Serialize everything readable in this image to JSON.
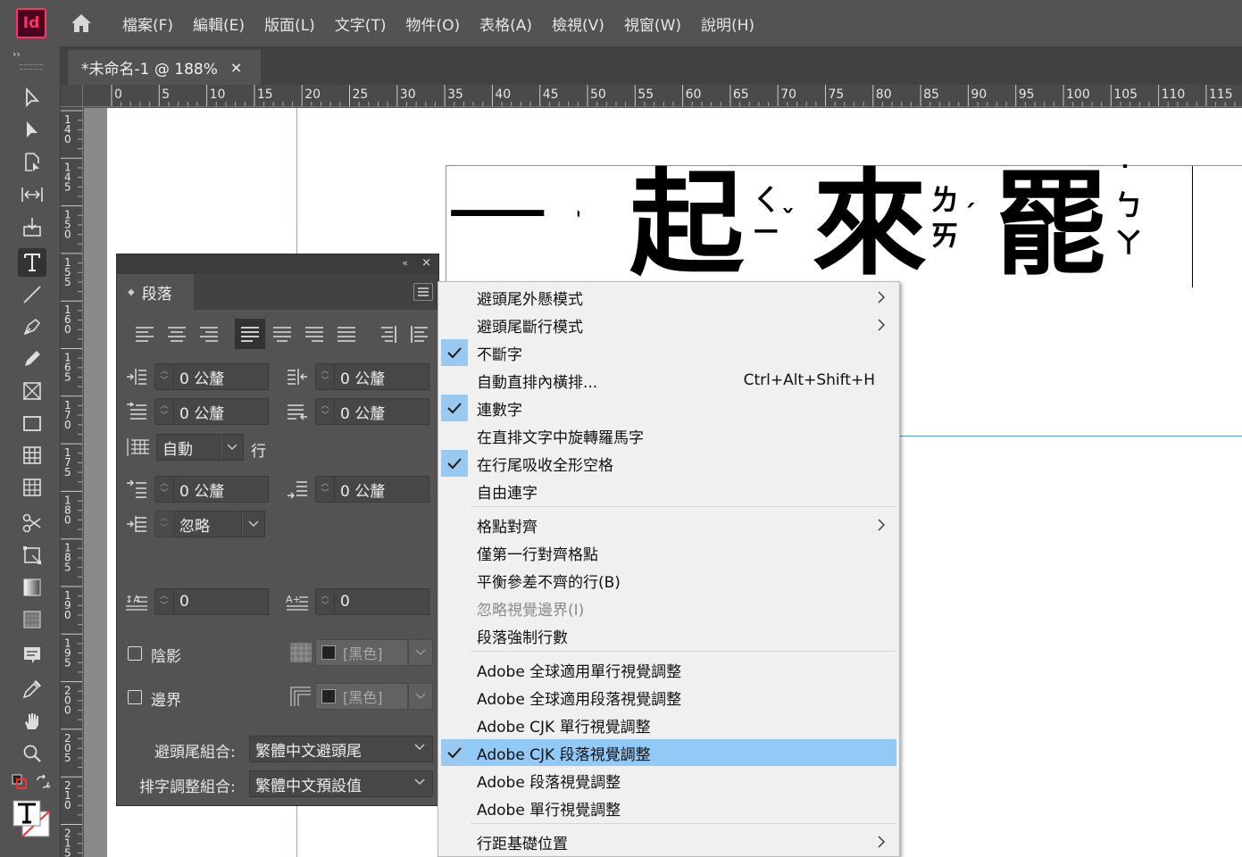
{
  "app": {
    "logo": "Id"
  },
  "menu": [
    "檔案(F)",
    "編輯(E)",
    "版面(L)",
    "文字(T)",
    "物件(O)",
    "表格(A)",
    "檢視(V)",
    "視窗(W)",
    "說明(H)"
  ],
  "tab": {
    "title": "*未命名-1 @ 188%",
    "close": "×"
  },
  "ruler": {
    "h_labels": [
      "0",
      "5",
      "10",
      "15",
      "20",
      "25",
      "30",
      "35",
      "40",
      "45",
      "50",
      "55",
      "60",
      "65",
      "70",
      "75",
      "80",
      "85",
      "90",
      "95",
      "100",
      "105",
      "110",
      "115"
    ],
    "v_labels": [
      "140",
      "145",
      "150",
      "155",
      "160",
      "165",
      "170",
      "175",
      "180",
      "185",
      "190",
      "195",
      "200",
      "205",
      "210",
      "215"
    ]
  },
  "canvas_text": {
    "chars": [
      "一",
      "起",
      "來",
      "罷"
    ],
    "zhuyin": [
      "ˋ",
      "ㄑ",
      "ㄧ",
      "ˇ",
      "ㄌ",
      "ㄞ",
      "ˊ",
      "˙",
      "ㄅ",
      "ㄚ"
    ]
  },
  "panel": {
    "title": "段落",
    "collapse": "«",
    "close": "×",
    "left_indent": "0 公釐",
    "right_indent": "0 公釐",
    "first_line_indent": "0 公釐",
    "last_line_indent": "0 公釐",
    "auto_leading": "自動",
    "leading_unit": "行",
    "space_before": "0 公釐",
    "space_after": "0 公釐",
    "align_to_grid": "忽略",
    "drop_cap_lines": "0",
    "drop_cap_chars": "0",
    "shading_label": "陰影",
    "border_label": "邊界",
    "shading_color": "[黑色]",
    "border_color": "[黑色]",
    "kinsoku_label": "避頭尾組合:",
    "kinsoku_value": "繁體中文避頭尾",
    "mojikumi_label": "排字調整組合:",
    "mojikumi_value": "繁體中文預設值"
  },
  "context_menu": {
    "items": [
      {
        "label": "避頭尾外懸模式",
        "submenu": true
      },
      {
        "label": "避頭尾斷行模式",
        "submenu": true
      },
      {
        "label": "不斷字",
        "checked": true
      },
      {
        "label": "自動直排內橫排...",
        "shortcut": "Ctrl+Alt+Shift+H"
      },
      {
        "label": "連數字",
        "checked": true
      },
      {
        "label": "在直排文字中旋轉羅馬字"
      },
      {
        "label": "在行尾吸收全形空格",
        "checked": true
      },
      {
        "label": "自由連字"
      },
      {
        "label": "格點對齊",
        "submenu": true
      },
      {
        "label": "僅第一行對齊格點"
      },
      {
        "label": "平衡參差不齊的行(B)"
      },
      {
        "label": "忽略視覺邊界(I)",
        "disabled": true
      },
      {
        "label": "段落強制行數"
      },
      {
        "label": "Adobe 全球適用單行視覺調整"
      },
      {
        "label": "Adobe 全球適用段落視覺調整"
      },
      {
        "label": "Adobe CJK 單行視覺調整"
      },
      {
        "label": "Adobe CJK 段落視覺調整",
        "checked": true,
        "highlighted": true
      },
      {
        "label": "Adobe 段落視覺調整"
      },
      {
        "label": "Adobe 單行視覺調整"
      },
      {
        "label": "行距基礎位置",
        "submenu": true
      }
    ]
  },
  "colors": {
    "highlight": "#91c9f7",
    "check_bg": "#99c9ef",
    "logo": "#ff3366",
    "guide": "#5a9bdb"
  }
}
